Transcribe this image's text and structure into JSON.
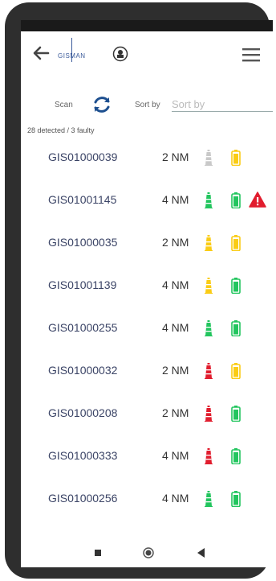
{
  "header": {
    "logo_text": "GISMAN",
    "back_icon": "back-arrow-icon",
    "menu_icon": "hamburger-menu-icon"
  },
  "controls": {
    "scan_label": "Scan",
    "sort_label": "Sort by",
    "sort_placeholder": "Sort by"
  },
  "summary": "28 detected / 3 faulty",
  "colors": {
    "green": "#22c55e",
    "yellow": "#facc15",
    "red": "#e11d2e",
    "gray": "#c9c9c9",
    "accent": "#1d4f8f"
  },
  "devices": [
    {
      "id": "GIS01000039",
      "range": "2 NM",
      "tower": "gray",
      "battery": "yellow",
      "warning": false
    },
    {
      "id": "GIS01001145",
      "range": "4 NM",
      "tower": "green",
      "battery": "green",
      "warning": true
    },
    {
      "id": "GIS01000035",
      "range": "2 NM",
      "tower": "yellow",
      "battery": "yellow",
      "warning": false
    },
    {
      "id": "GIS01001139",
      "range": "4 NM",
      "tower": "yellow",
      "battery": "green",
      "warning": false
    },
    {
      "id": "GIS01000255",
      "range": "4 NM",
      "tower": "green",
      "battery": "green",
      "warning": false
    },
    {
      "id": "GIS01000032",
      "range": "2 NM",
      "tower": "red",
      "battery": "yellow",
      "warning": false
    },
    {
      "id": "GIS01000208",
      "range": "2 NM",
      "tower": "red",
      "battery": "green",
      "warning": false
    },
    {
      "id": "GIS01000333",
      "range": "4 NM",
      "tower": "red",
      "battery": "green",
      "warning": false
    },
    {
      "id": "GIS01000256",
      "range": "4 NM",
      "tower": "green",
      "battery": "green",
      "warning": false
    }
  ]
}
